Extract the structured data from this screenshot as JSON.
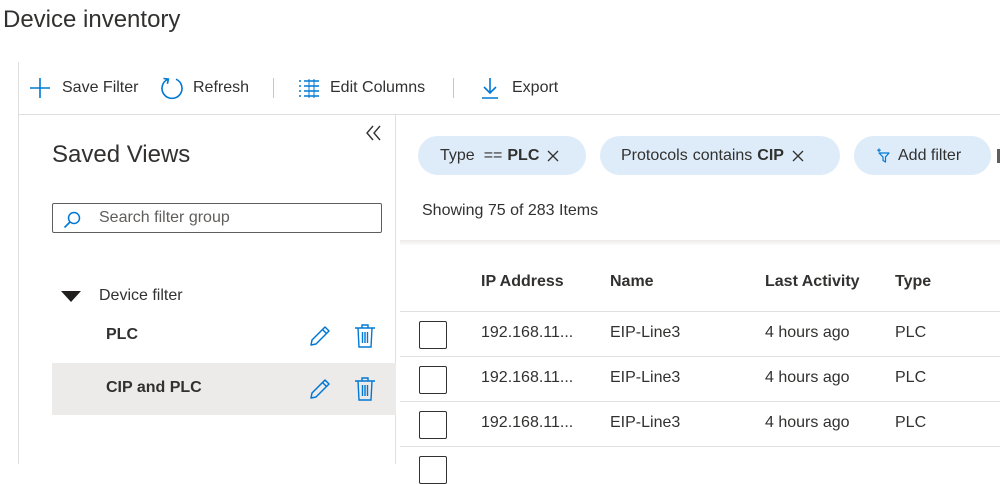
{
  "page_title": "Device inventory",
  "toolbar": {
    "save_filter": "Save Filter",
    "refresh": "Refresh",
    "edit_columns": "Edit Columns",
    "export": "Export"
  },
  "saved_views": {
    "title": "Saved Views",
    "search_placeholder": "Search filter group",
    "group_label": "Device filter",
    "views": [
      {
        "name": "PLC",
        "selected": false
      },
      {
        "name": "CIP and PLC",
        "selected": true
      }
    ]
  },
  "filters": {
    "pills": [
      {
        "field": "Type",
        "op": "==",
        "value": "PLC"
      },
      {
        "field": "Protocols",
        "op": "contains",
        "value": "CIP"
      }
    ],
    "add_filter": "Add filter"
  },
  "results": {
    "showing": "Showing 75 of 283 Items"
  },
  "grid": {
    "columns": [
      "IP Address",
      "Name",
      "Last Activity",
      "Type"
    ],
    "rows": [
      {
        "ip": "192.168.11...",
        "name": "EIP-Line3",
        "last_activity": "4 hours ago",
        "type": "PLC"
      },
      {
        "ip": "192.168.11...",
        "name": "EIP-Line3",
        "last_activity": "4 hours ago",
        "type": "PLC"
      },
      {
        "ip": "192.168.11...",
        "name": "EIP-Line3",
        "last_activity": "4 hours ago",
        "type": "PLC"
      }
    ]
  },
  "colors": {
    "accent": "#0078d4",
    "pill_bg": "#deecf9",
    "selected_row": "#edebe9"
  },
  "icons": [
    "add-icon",
    "refresh-icon",
    "edit-columns-icon",
    "export-icon",
    "collapse-icon",
    "search-icon",
    "chevron-down-icon",
    "edit-icon",
    "delete-icon",
    "close-icon",
    "add-filter-icon"
  ]
}
